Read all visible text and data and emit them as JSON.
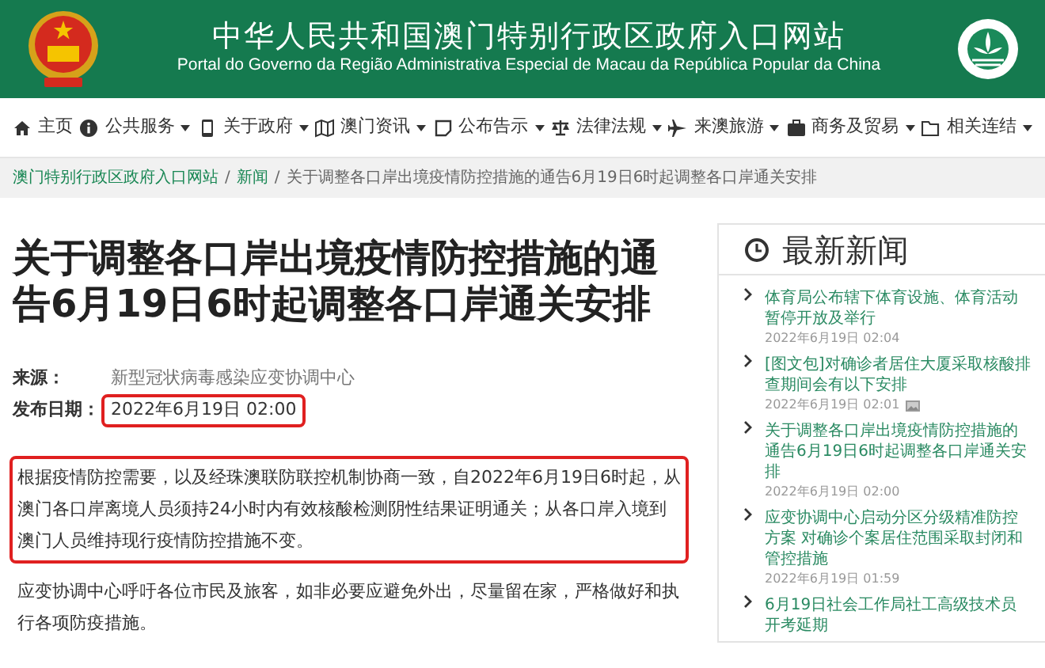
{
  "header": {
    "title": "中华人民共和国澳门特别行政区政府入口网站",
    "subtitle": "Portal do Governo da Região Administrativa Especial de Macau da República Popular da China"
  },
  "nav": [
    {
      "label": "主页",
      "dropdown": false
    },
    {
      "label": "公共服务",
      "dropdown": true
    },
    {
      "label": "关于政府",
      "dropdown": true
    },
    {
      "label": "澳门资讯",
      "dropdown": true
    },
    {
      "label": "公布告示",
      "dropdown": true
    },
    {
      "label": "法律法规",
      "dropdown": true
    },
    {
      "label": "来澳旅游",
      "dropdown": true
    },
    {
      "label": "商务及贸易",
      "dropdown": true
    },
    {
      "label": "相关连结",
      "dropdown": true
    }
  ],
  "breadcrumb_separators": [
    "/",
    "/"
  ],
  "breadcrumb": [
    {
      "label": "澳门特别行政区政府入口网站",
      "link": true
    },
    {
      "label": "新闻",
      "link": true
    },
    {
      "label": "关于调整各口岸出境疫情防控措施的通告6月19日6时起调整各口岸通关安排",
      "link": false
    }
  ],
  "article": {
    "title": "关于调整各口岸出境疫情防控措施的通告6月19日6时起调整各口岸通关安排",
    "meta": [
      {
        "label": "来源：",
        "value": "新型冠状病毒感染应变协调中心",
        "highlighted": false
      },
      {
        "label": "发布日期：",
        "value": "2022年6月19日 02:00",
        "highlighted": true
      }
    ],
    "paragraphs": [
      {
        "text": "根据疫情防控需要，以及经珠澳联防联控机制协商一致，自2022年6月19日6时起，从澳门各口岸离境人员须持24小时内有效核酸检测阴性结果证明通关；从各口岸入境到澳门人员维持现行疫情防控措施不变。",
        "highlighted": true
      },
      {
        "text": "应变协调中心呼吁各位市民及旅客，如非必要应避免外出，尽量留在家，严格做好和执行各项防疫措施。",
        "highlighted": false
      }
    ]
  },
  "latest_news": {
    "heading": "最新新闻",
    "items": [
      {
        "title": "体育局公布辖下体育设施、体育活动暂停开放及举行",
        "date": "2022年6月19日 02:04",
        "has_image": false
      },
      {
        "title": "[图文包]对确诊者居住大厦采取核酸排查期间会有以下安排",
        "date": "2022年6月19日 02:01",
        "has_image": true
      },
      {
        "title": "关于调整各口岸出境疫情防控措施的通告6月19日6时起调整各口岸通关安排",
        "date": "2022年6月19日 02:00",
        "has_image": false
      },
      {
        "title": "应变协调中心启动分区分级精准防控方案 对确诊个案居住范围采取封闭和管控措施",
        "date": "2022年6月19日 01:59",
        "has_image": false
      },
      {
        "title": "6月19日社会工作局社工高级技术员开考延期",
        "has_image": false
      }
    ]
  }
}
